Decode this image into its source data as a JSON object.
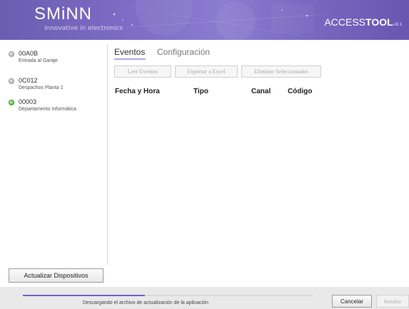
{
  "header": {
    "logo_text": "SMiNN",
    "tagline": "innovative in electronics",
    "brand_prefix": "ACCESS",
    "brand_bold": "TOOL",
    "brand_version": "v8.1",
    "gradient_start": "#6a5db0",
    "gradient_end": "#6757b2"
  },
  "devices": [
    {
      "id": "00A0B",
      "description": "Entrada al Garaje",
      "status": "offline"
    },
    {
      "id": "0C012",
      "description": "Despachos Planta 1",
      "status": "offline"
    },
    {
      "id": "00003",
      "description": "Departamento Informática",
      "status": "online"
    }
  ],
  "tabs": [
    {
      "label": "Eventos",
      "active": true
    },
    {
      "label": "Configuración",
      "active": false
    }
  ],
  "toolbar": {
    "read_events": "Leer Eventos",
    "export_excel": "Exportar a Excel",
    "delete_selected": "Eliminar Seleccionados"
  },
  "table": {
    "columns": [
      "Fecha y Hora",
      "Tipo",
      "Canal",
      "Código"
    ]
  },
  "footer": {
    "update_devices": "Actualizar Dispositivos",
    "status_text": "Descargando el archivo de actualización de la aplicación",
    "progress": 0.42,
    "progress_color": "#6f64c6",
    "cancel": "Cancelar",
    "install": "Instalar"
  }
}
